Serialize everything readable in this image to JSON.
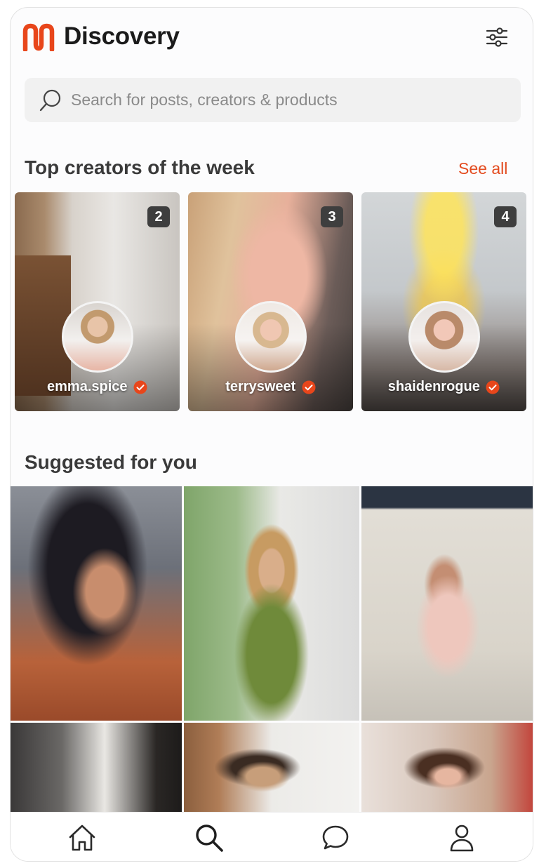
{
  "app": {
    "title": "Discovery"
  },
  "search": {
    "placeholder": "Search for posts, creators & products"
  },
  "top_creators": {
    "title": "Top creators of the week",
    "see_all_label": "See all",
    "cards": [
      {
        "rank": "2",
        "username": "emma.spice",
        "verified": true
      },
      {
        "rank": "3",
        "username": "terrysweet",
        "verified": true
      },
      {
        "rank": "4",
        "username": "shaidenrogue",
        "verified": true
      }
    ]
  },
  "suggested": {
    "title": "Suggested for you"
  },
  "nav": {
    "items": [
      "home-icon",
      "search-icon",
      "chat-icon",
      "profile-icon"
    ]
  },
  "colors": {
    "accent": "#e34b1f",
    "badge_bg": "#3e3e3e",
    "search_bg": "#f1f1f1"
  }
}
